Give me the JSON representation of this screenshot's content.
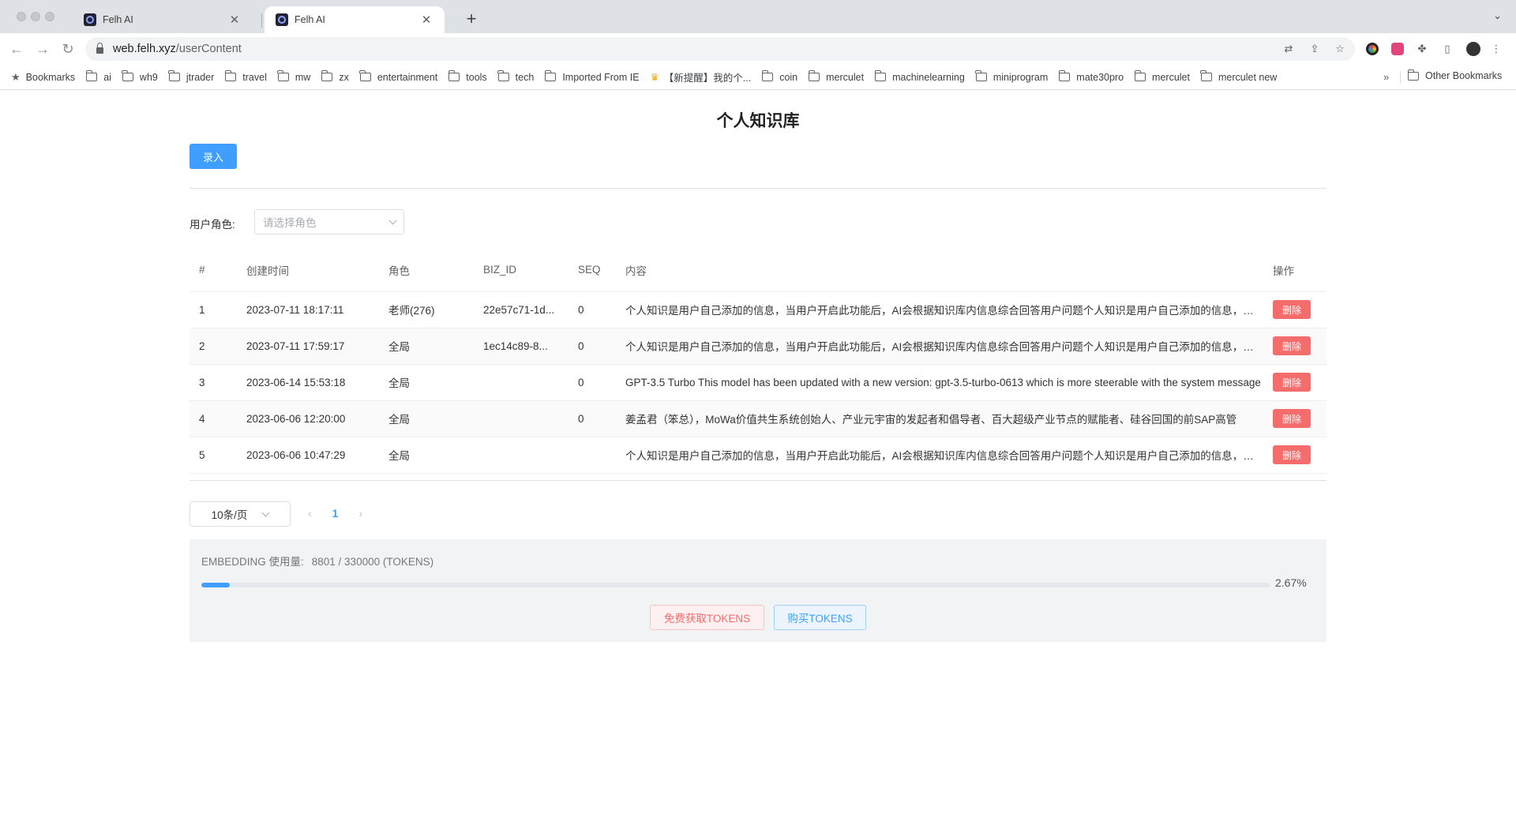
{
  "browser": {
    "tabs": [
      {
        "title": "Felh AI"
      },
      {
        "title": "Felh AI"
      }
    ],
    "new_tab_symbol": "+",
    "close_symbol": "✕",
    "url_host": "web.felh.xyz",
    "url_path": "/userContent",
    "bookmarks_label": "Bookmarks",
    "bookmark_folders": [
      "ai",
      "wh9",
      "jtrader",
      "travel",
      "mw",
      "zx",
      "entertainment",
      "tools",
      "tech",
      "Imported From IE",
      "【新提醒】我的个...",
      "coin",
      "merculet",
      "machinelearning",
      "miniprogram",
      "mate30pro",
      "merculet",
      "merculet new"
    ],
    "bookmarks_more": "»",
    "other_bookmarks": "Other Bookmarks"
  },
  "page": {
    "title": "个人知识库",
    "add_button": "录入",
    "filter": {
      "label": "用户角色:",
      "placeholder": "请选择角色"
    },
    "table": {
      "headers": [
        "#",
        "创建时间",
        "角色",
        "BIZ_ID",
        "SEQ",
        "内容",
        "操作"
      ],
      "delete_label": "删除",
      "rows": [
        {
          "index": "1",
          "created": "2023-07-11 18:17:11",
          "role": "老师(276)",
          "biz_id": "22e57c71-1d...",
          "seq": "0",
          "content": "个人知识是用户自己添加的信息，当用户开启此功能后，AI会根据知识库内信息综合回答用户问题个人知识是用户自己添加的信息，当用户开启此功能后"
        },
        {
          "index": "2",
          "created": "2023-07-11 17:59:17",
          "role": "全局",
          "biz_id": "1ec14c89-8...",
          "seq": "0",
          "content": "个人知识是用户自己添加的信息，当用户开启此功能后，AI会根据知识库内信息综合回答用户问题个人知识是用户自己添加的信息，当用户开启此功能后"
        },
        {
          "index": "3",
          "created": "2023-06-14 15:53:18",
          "role": "全局",
          "biz_id": "",
          "seq": "0",
          "content": "GPT-3.5 Turbo This model has been updated with a new version: gpt-3.5-turbo-0613 which is more steerable with the system message"
        },
        {
          "index": "4",
          "created": "2023-06-06 12:20:00",
          "role": "全局",
          "biz_id": "",
          "seq": "0",
          "content": "姜孟君（笨总），MoWa价值共生系统创始人、产业元宇宙的发起者和倡导者、百大超级产业节点的赋能者、硅谷回国的前SAP高管"
        },
        {
          "index": "5",
          "created": "2023-06-06 10:47:29",
          "role": "全局",
          "biz_id": "",
          "seq": "",
          "content": "个人知识是用户自己添加的信息，当用户开启此功能后，AI会根据知识库内信息综合回答用户问题个人知识是用户自己添加的信息，当用户开启此功能后"
        }
      ]
    },
    "pagination": {
      "page_size": "10条/页",
      "prev": "‹",
      "current": "1",
      "next": "›"
    },
    "usage": {
      "label": "EMBEDDING 使用量:",
      "value": "8801 / 330000 (TOKENS)",
      "progress_fraction": 0.0267,
      "progress_text": "2.67%",
      "free_button": "免费获取TOKENS",
      "buy_button": "购买TOKENS"
    }
  },
  "colors": {
    "primary": "#409eff",
    "danger": "#f56c6c"
  }
}
